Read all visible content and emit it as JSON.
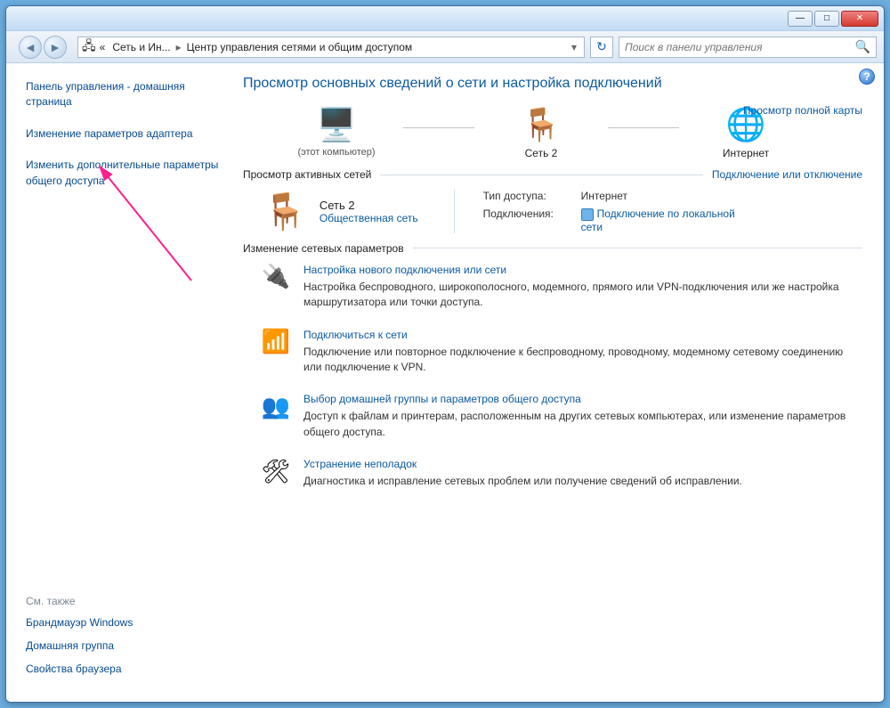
{
  "titlebar": {
    "minimize": "—",
    "maximize": "□",
    "close": "✕"
  },
  "addressbar": {
    "back": "◄",
    "forward": "►",
    "crumb_prefix": "«",
    "crumb1": "Сеть и Ин...",
    "crumb2": "Центр управления сетями и общим доступом",
    "dropdown": "▾",
    "refresh": "↻",
    "search_placeholder": "Поиск в панели управления",
    "search_icon": "🔍"
  },
  "sidebar": {
    "home": "Панель управления - домашняя страница",
    "adapter": "Изменение параметров адаптера",
    "sharing": "Изменить дополнительные параметры общего доступа",
    "see_also_header": "См. также",
    "see_also": [
      "Брандмауэр Windows",
      "Домашняя группа",
      "Свойства браузера"
    ]
  },
  "help": "?",
  "page_title": "Просмотр основных сведений о сети и настройка подключений",
  "map": {
    "computer_label": "",
    "computer_sub": "(этот компьютер)",
    "net_label": "Сеть  2",
    "inet_label": "Интернет",
    "full_map": "Просмотр полной карты"
  },
  "active_header": "Просмотр активных сетей",
  "active_link": "Подключение или отключение",
  "active": {
    "name": "Сеть  2",
    "type": "Общественная сеть",
    "access_lbl": "Тип доступа:",
    "access_val": "Интернет",
    "conn_lbl": "Подключения:",
    "conn_val": "Подключение по локальной сети"
  },
  "change_header": "Изменение сетевых параметров",
  "tasks": [
    {
      "icon": "🔌",
      "title": "Настройка нового подключения или сети",
      "desc": "Настройка беспроводного, широкополосного, модемного, прямого или VPN-подключения или же настройка маршрутизатора или точки доступа."
    },
    {
      "icon": "📶",
      "title": "Подключиться к сети",
      "desc": "Подключение или повторное подключение к беспроводному, проводному, модемному сетевому соединению или подключение к VPN."
    },
    {
      "icon": "👥",
      "title": "Выбор домашней группы и параметров общего доступа",
      "desc": "Доступ к файлам и принтерам, расположенным на других сетевых компьютерах, или изменение параметров общего доступа."
    },
    {
      "icon": "🛠",
      "title": "Устранение неполадок",
      "desc": "Диагностика и исправление сетевых проблем или получение сведений об исправлении."
    }
  ]
}
